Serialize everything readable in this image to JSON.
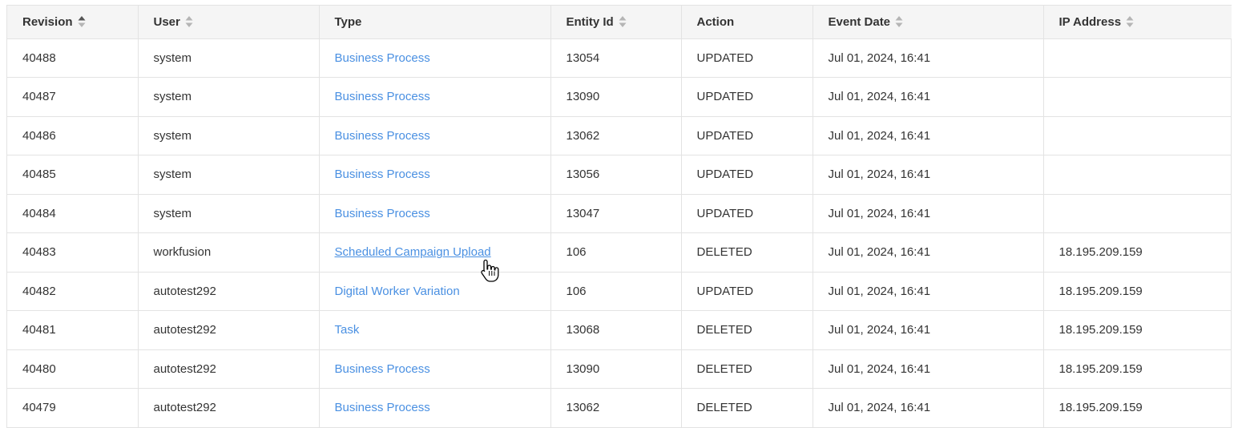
{
  "table": {
    "columns": [
      {
        "label": "Revision",
        "sortable": true,
        "sort": "asc"
      },
      {
        "label": "User",
        "sortable": true,
        "sort": "none"
      },
      {
        "label": "Type",
        "sortable": false,
        "sort": "none"
      },
      {
        "label": "Entity Id",
        "sortable": true,
        "sort": "none"
      },
      {
        "label": "Action",
        "sortable": false,
        "sort": "none"
      },
      {
        "label": "Event Date",
        "sortable": true,
        "sort": "none"
      },
      {
        "label": "IP Address",
        "sortable": true,
        "sort": "none"
      }
    ],
    "rows": [
      {
        "revision": "40488",
        "user": "system",
        "type": "Business Process",
        "entity_id": "13054",
        "action": "UPDATED",
        "event_date": "Jul 01, 2024, 16:41",
        "ip": ""
      },
      {
        "revision": "40487",
        "user": "system",
        "type": "Business Process",
        "entity_id": "13090",
        "action": "UPDATED",
        "event_date": "Jul 01, 2024, 16:41",
        "ip": ""
      },
      {
        "revision": "40486",
        "user": "system",
        "type": "Business Process",
        "entity_id": "13062",
        "action": "UPDATED",
        "event_date": "Jul 01, 2024, 16:41",
        "ip": ""
      },
      {
        "revision": "40485",
        "user": "system",
        "type": "Business Process",
        "entity_id": "13056",
        "action": "UPDATED",
        "event_date": "Jul 01, 2024, 16:41",
        "ip": ""
      },
      {
        "revision": "40484",
        "user": "system",
        "type": "Business Process",
        "entity_id": "13047",
        "action": "UPDATED",
        "event_date": "Jul 01, 2024, 16:41",
        "ip": ""
      },
      {
        "revision": "40483",
        "user": "workfusion",
        "type": "Scheduled Campaign Upload",
        "entity_id": "106",
        "action": "DELETED",
        "event_date": "Jul 01, 2024, 16:41",
        "ip": "18.195.209.159"
      },
      {
        "revision": "40482",
        "user": "autotest292",
        "type": "Digital Worker Variation",
        "entity_id": "106",
        "action": "UPDATED",
        "event_date": "Jul 01, 2024, 16:41",
        "ip": "18.195.209.159"
      },
      {
        "revision": "40481",
        "user": "autotest292",
        "type": "Task",
        "entity_id": "13068",
        "action": "DELETED",
        "event_date": "Jul 01, 2024, 16:41",
        "ip": "18.195.209.159"
      },
      {
        "revision": "40480",
        "user": "autotest292",
        "type": "Business Process",
        "entity_id": "13090",
        "action": "DELETED",
        "event_date": "Jul 01, 2024, 16:41",
        "ip": "18.195.209.159"
      },
      {
        "revision": "40479",
        "user": "autotest292",
        "type": "Business Process",
        "entity_id": "13062",
        "action": "DELETED",
        "event_date": "Jul 01, 2024, 16:41",
        "ip": "18.195.209.159"
      }
    ],
    "hovered_row": 5
  },
  "colors": {
    "link": "#4a90e2",
    "header_bg": "#f5f5f5",
    "border": "#e3e3e3",
    "text": "#333333",
    "sort_active": "#555555",
    "sort_inactive": "#b5b5b5"
  },
  "icons": {
    "sort": "sort-arrows-icon",
    "cursor": "hand-pointer-cursor-icon"
  }
}
